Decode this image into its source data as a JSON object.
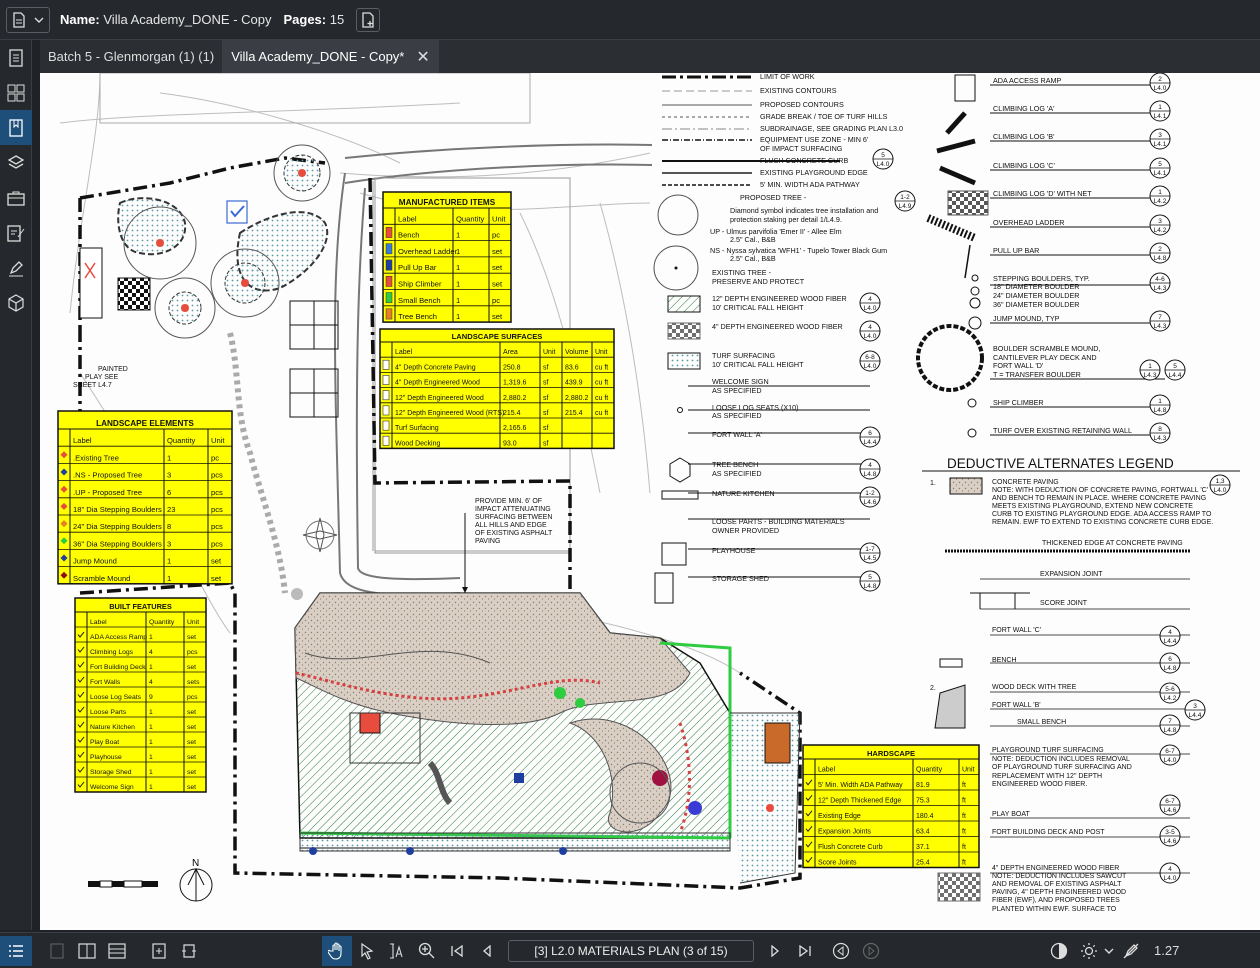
{
  "header": {
    "name_label": "Name:",
    "name_value": "Villa Academy_DONE - Copy",
    "pages_label": "Pages:",
    "pages_value": "15"
  },
  "tabs": [
    {
      "label": "Batch 5 - Glenmorgan (1) (1)"
    },
    {
      "label": "Villa Academy_DONE - Copy*"
    }
  ],
  "drawing": {
    "manufactured": {
      "title": "MANUFACTURED ITEMS",
      "cols": [
        "Label",
        "Quantity",
        "Unit"
      ],
      "rows": [
        [
          "Bench",
          "1",
          "pc"
        ],
        [
          "Overhead Ladder",
          "1",
          "set"
        ],
        [
          "Pull Up Bar",
          "1",
          "set"
        ],
        [
          "Ship Climber",
          "1",
          "set"
        ],
        [
          "Small Bench",
          "1",
          "pc"
        ],
        [
          "Tree Bench",
          "1",
          "set"
        ]
      ],
      "colors": [
        "#e74c3c",
        "#3a7bd5",
        "#1f3fa0",
        "#e74c3c",
        "#2ecc40",
        "#e67e22"
      ]
    },
    "surfaces": {
      "title": "LANDSCAPE SURFACES",
      "cols": [
        "Label",
        "Area",
        "Unit",
        "Volume",
        "Unit"
      ],
      "rows": [
        [
          "4\" Depth Concrete Paving",
          "250.8",
          "sf",
          "83.6",
          "cu ft"
        ],
        [
          "4\" Depth Engineered Wood",
          "1,319.6",
          "sf",
          "439.9",
          "cu ft"
        ],
        [
          "12\" Depth Engineered Wood",
          "2,880.2",
          "sf",
          "2,880.2",
          "cu ft"
        ],
        [
          "12\" Depth Engineered Wood (RTS)",
          "215.4",
          "sf",
          "215.4",
          "cu ft"
        ],
        [
          "Turf Surfacing",
          "2,165.6",
          "sf",
          "",
          ""
        ],
        [
          "Wood Decking",
          "93.0",
          "sf",
          "",
          ""
        ]
      ]
    },
    "elements": {
      "title": "LANDSCAPE ELEMENTS",
      "cols": [
        "Label",
        "Quantity",
        "Unit"
      ],
      "rows": [
        [
          ".Existing Tree",
          "1",
          "pc"
        ],
        [
          ".NS - Proposed Tree",
          "3",
          "pcs"
        ],
        [
          ".UP - Proposed Tree",
          "6",
          "pcs"
        ],
        [
          "18\" Dia Stepping Boulders",
          "23",
          "pcs"
        ],
        [
          "24\" Dia Stepping Boulders",
          "8",
          "pcs"
        ],
        [
          "36\" Dia Stepping Boulders",
          "3",
          "pcs"
        ],
        [
          "Jump Mound",
          "1",
          "set"
        ],
        [
          "Scramble Mound",
          "1",
          "set"
        ]
      ],
      "colors": [
        "#e74c3c",
        "#1f3fa0",
        "#e74c3c",
        "#e74c3c",
        "#e67e22",
        "#2ecc40",
        "#1f3fa0",
        "#8e1010"
      ]
    },
    "built": {
      "title": "BUILT FEATURES",
      "cols": [
        "Label",
        "Quantity",
        "Unit"
      ],
      "rows": [
        [
          "ADA Access Ramp",
          "1",
          "set"
        ],
        [
          "Climbing Logs",
          "4",
          "pcs"
        ],
        [
          "Fort Building Deck",
          "1",
          "set"
        ],
        [
          "Fort Walls",
          "4",
          "sets"
        ],
        [
          "Loose Log Seats",
          "9",
          "pcs"
        ],
        [
          "Loose Parts",
          "1",
          "set"
        ],
        [
          "Nature Kitchen",
          "1",
          "set"
        ],
        [
          "Play Boat",
          "1",
          "set"
        ],
        [
          "Playhouse",
          "1",
          "set"
        ],
        [
          "Storage Shed",
          "1",
          "set"
        ],
        [
          "Welcome Sign",
          "1",
          "set"
        ]
      ]
    },
    "hardscape": {
      "title": "HARDSCAPE",
      "cols": [
        "Label",
        "Quantity",
        "Unit"
      ],
      "rows": [
        [
          "5' Min. Width ADA Pathway",
          "81.9",
          "ft"
        ],
        [
          "12\" Depth Thickened Edge",
          "75.3",
          "ft"
        ],
        [
          "Existing Edge",
          "180.4",
          "ft"
        ],
        [
          "Expansion Joints",
          "63.4",
          "ft"
        ],
        [
          "Flush Concrete Curb",
          "37.1",
          "ft"
        ],
        [
          "Score Joints",
          "25.4",
          "ft"
        ]
      ]
    },
    "legend_mid": [
      "LIMIT OF WORK",
      "EXISTING CONTOURS",
      "PROPOSED CONTOURS",
      "GRADE BREAK / TOE OF TURF HILLS",
      "SUBDRAINAGE, SEE GRADING PLAN L3.0",
      "EQUIPMENT USE ZONE - MIN 6'",
      "OF IMPACT SURFACING",
      "FLUSH CONCRETE CURB",
      "EXISTING PLAYGROUND EDGE",
      "5' MIN. WIDTH ADA PATHWAY",
      "PROPOSED TREE -",
      "Diamond symbol indicates tree installation and",
      "protection staking per detail 1/L4.9.",
      "UP - Ulmus parvifolia 'Emer II' - Allee Elm",
      "2.5\" Cal., B&B",
      "NS - Nyssa sylvatica 'WFH1' - Tupelo Tower Black Gum",
      "2.5\" Cal., B&B",
      "EXISTING TREE -",
      "PRESERVE AND PROTECT",
      "12\" DEPTH ENGINEERED WOOD FIBER",
      "10' CRITICAL FALL HEIGHT",
      "4\" DEPTH ENGINEERED WOOD FIBER",
      "TURF SURFACING",
      "10' CRITICAL FALL HEIGHT",
      "WELCOME SIGN",
      "AS SPECIFIED",
      "LOOSE LOG SEATS (X10)",
      "AS SPECIFIED",
      "FORT WALL 'A'",
      "TREE BENCH",
      "AS SPECIFIED",
      "NATURE KITCHEN",
      "LOOSE PARTS - BUILDING MATERIALS",
      "OWNER PROVIDED",
      "PLAYHOUSE",
      "STORAGE SHED"
    ],
    "legend_right": [
      "ADA ACCESS RAMP",
      "CLIMBING LOG 'A'",
      "CLIMBING LOG 'B'",
      "CLIMBING LOG 'C'",
      "CLIMBING LOG 'D' WITH NET",
      "OVERHEAD LADDER",
      "PULL UP BAR",
      "STEPPING BOULDERS, TYP.",
      "18\" DIAMETER BOULDER",
      "24\" DIAMETER BOULDER",
      "36\" DIAMETER BOULDER",
      "JUMP MOUND, TYP",
      "BOULDER SCRAMBLE MOUND,",
      "CANTILEVER PLAY DECK AND",
      "FORT WALL 'D'",
      "T = TRANSFER BOULDER",
      "SHIP CLIMBER",
      "TURF OVER EXISTING RETAINING WALL"
    ],
    "deductive_title": "DEDUCTIVE ALTERNATES LEGEND",
    "deductive": [
      "CONCRETE PAVING",
      "NOTE: WITH DEDUCTION OF CONCRETE PAVING, FORTWALL 'C'",
      "AND BENCH TO REMAIN IN PLACE. WHERE CONCRETE PAVING",
      "MEETS EXISTING PLAYGROUND, EXTEND NEW CONCRETE",
      "CURB TO EXISTING PLAYGROUND EDGE. ADA ACCESS RAMP TO",
      "REMAIN. EWF TO EXTEND TO EXISTING CONCRETE CURB EDGE.",
      "THICKENED  EDGE AT CONCRETE PAVING",
      "EXPANSION JOINT",
      "SCORE JOINT",
      "FORT WALL 'C'",
      "BENCH",
      "WOOD DECK WITH TREE",
      "FORT WALL 'B'",
      "SMALL BENCH",
      "PLAYGROUND TURF SURFACING",
      "NOTE: DEDUCTION INCLUDES REMOVAL",
      "OF PLAYGROUND TURF SURFACING AND",
      "REPLACEMENT WITH 12\" DEPTH",
      "ENGINEERED WOOD FIBER.",
      "PLAY BOAT",
      "FORT BUILDING DECK AND POST",
      "4\" DEPTH ENGINEERED WOOD FIBER",
      "NOTE: DEDUCTION INCLUDES SAWCUT",
      "AND REMOVAL OF EXISTING ASPHALT",
      "PAVING, 4\" DEPTH ENGINEERED WOOD",
      "FIBER (EWF), AND PROPOSED TREES",
      "PLANTED WITHIN EWF. SURFACE TO"
    ],
    "notes": {
      "painted": [
        "PAINTED",
        "PLAY SEE",
        "SHEET L4.7"
      ],
      "provide": [
        "PROVIDE MIN. 6' OF",
        "IMPACT ATTENUATING",
        "SURFACING BETWEEN",
        "ALL HILLS AND EDGE",
        "OF EXISTING ASPHALT",
        "PAVING"
      ],
      "north": "N"
    }
  },
  "footer": {
    "page_select": "[3] L2.0 MATERIALS PLAN (3 of 15)",
    "zoom": "1.27"
  }
}
